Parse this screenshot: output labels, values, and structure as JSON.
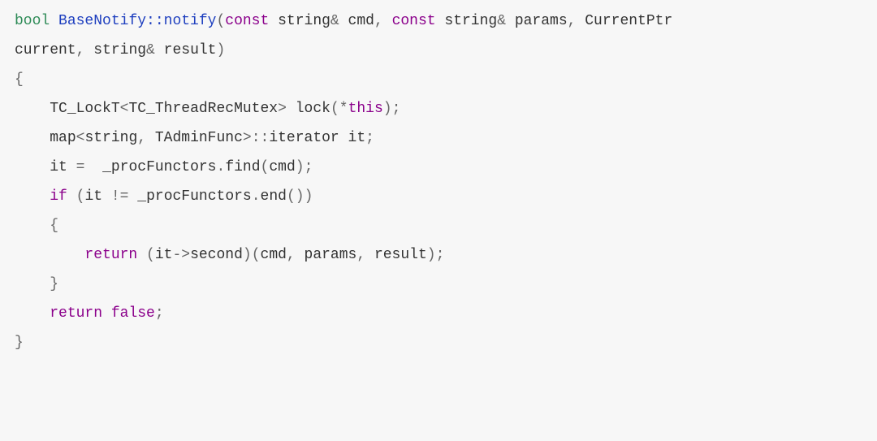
{
  "code": {
    "l1": {
      "bool": "bool",
      "sp1": " ",
      "qual": "BaseNotify::notify",
      "op1": "(",
      "const1": "const",
      "sp2": " ",
      "string1": "string",
      "amp1": "&",
      "sp3": " ",
      "cmd": "cmd",
      "com1": ", ",
      "const2": "const",
      "sp4": " ",
      "string2": "string",
      "amp2": "&",
      "sp5": " ",
      "params": "params",
      "com2": ", ",
      "cur": "CurrentPtr"
    },
    "l2": {
      "current": "current",
      "com": ", ",
      "string": "string",
      "amp": "&",
      "sp": " ",
      "result": "result",
      "close": ")"
    },
    "l3": {
      "brace": "{"
    },
    "l4": {
      "indent": "    ",
      "tc": "TC_LockT",
      "lt": "<",
      "mutex": "TC_ThreadRecMutex",
      "gt": ">",
      "sp": " ",
      "lock": "lock",
      "op1": "(",
      "star": "*",
      "this": "this",
      "op2": ")",
      "semi": ";"
    },
    "l5": {
      "blank": ""
    },
    "l6": {
      "indent": "    ",
      "map": "map",
      "lt": "<",
      "string": "string",
      "com": ", ",
      "func": "TAdminFunc",
      "gt": ">",
      "dcolon": "::",
      "iter": "iterator",
      "sp": " ",
      "it": "it",
      "semi": ";"
    },
    "l7": {
      "blank": ""
    },
    "l8": {
      "indent": "    ",
      "it": "it",
      "sp1": " ",
      "eq": "=",
      "sp2": "  ",
      "proc": "_procFunctors",
      "dot": ".",
      "find": "find",
      "op1": "(",
      "cmd": "cmd",
      "op2": ")",
      "semi": ";"
    },
    "l9": {
      "blank": ""
    },
    "l10": {
      "indent": "    ",
      "if": "if",
      "sp1": " ",
      "op1": "(",
      "it": "it",
      "sp2": " ",
      "neq": "!=",
      "sp3": " ",
      "proc": "_procFunctors",
      "dot": ".",
      "end": "end",
      "op2": "(",
      "op3": ")",
      "op4": ")"
    },
    "l11": {
      "indent": "    ",
      "brace": "{"
    },
    "l12": {
      "indent": "        ",
      "ret": "return",
      "sp1": " ",
      "op1": "(",
      "it": "it",
      "arrow": "->",
      "second": "second",
      "op2": ")",
      "op3": "(",
      "cmd": "cmd",
      "com1": ", ",
      "params": "params",
      "com2": ", ",
      "result": "result",
      "op4": ")",
      "semi": ";"
    },
    "l13": {
      "indent": "    ",
      "brace": "}"
    },
    "l14": {
      "indent": "    ",
      "ret": "return",
      "sp": " ",
      "false": "false",
      "semi": ";"
    },
    "l15": {
      "brace": "}"
    }
  }
}
